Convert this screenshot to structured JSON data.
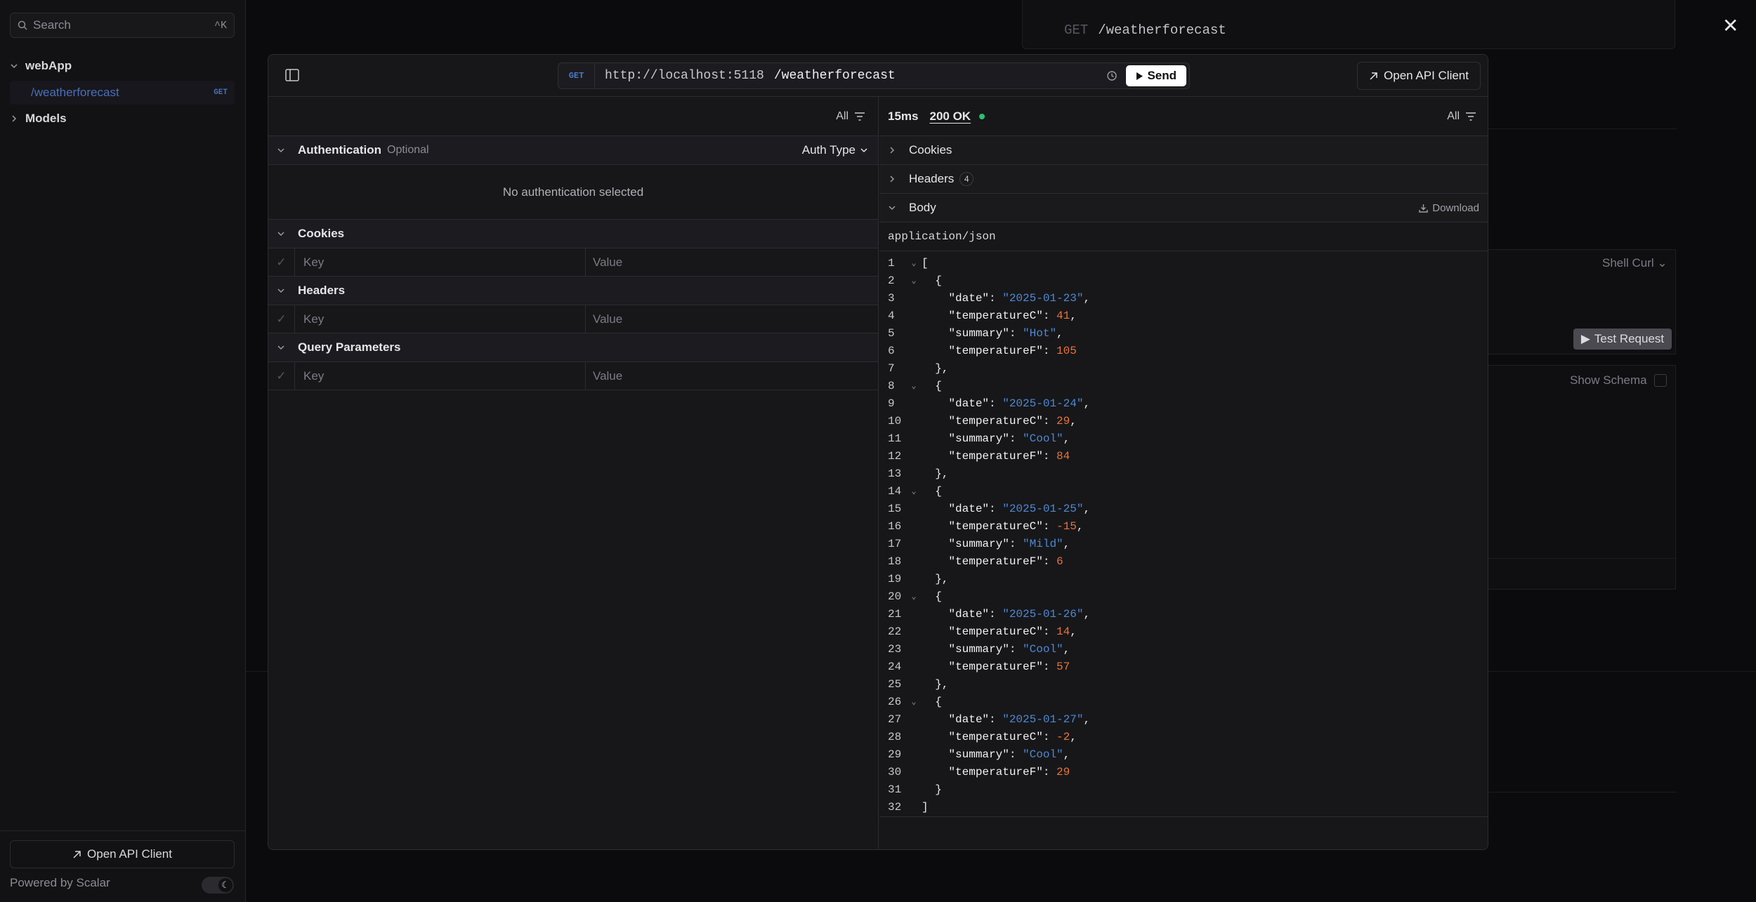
{
  "sidebar": {
    "search_placeholder": "Search",
    "search_shortcut": "^K",
    "group_webapp": "webApp",
    "item_weather": "/weatherforecast",
    "item_weather_method": "GET",
    "group_models": "Models",
    "open_api_client": "Open API Client",
    "powered_by": "Powered by Scalar"
  },
  "background": {
    "method": "GET",
    "path": "/weatherforecast",
    "shell": "Shell Curl",
    "test_request": "Test Request",
    "show_schema": "Show Schema"
  },
  "topbar": {
    "method": "GET",
    "host": "http://localhost:5118",
    "path": "/weatherforecast",
    "send": "Send",
    "open_api_client": "Open API Client"
  },
  "request": {
    "filter": "All",
    "auth_title": "Authentication",
    "auth_optional": "Optional",
    "auth_type": "Auth Type",
    "no_auth": "No authentication selected",
    "cookies": "Cookies",
    "headers": "Headers",
    "query": "Query Parameters",
    "key_placeholder": "Key",
    "value_placeholder": "Value"
  },
  "response": {
    "timing": "15ms",
    "status": "200 OK",
    "filter": "All",
    "cookies": "Cookies",
    "headers": "Headers",
    "headers_count": "4",
    "body": "Body",
    "download": "Download",
    "content_type": "application/json",
    "records": [
      {
        "date": "2025-01-23",
        "temperatureC": 41,
        "summary": "Hot",
        "temperatureF": 105
      },
      {
        "date": "2025-01-24",
        "temperatureC": 29,
        "summary": "Cool",
        "temperatureF": 84
      },
      {
        "date": "2025-01-25",
        "temperatureC": -15,
        "summary": "Mild",
        "temperatureF": 6
      },
      {
        "date": "2025-01-26",
        "temperatureC": 14,
        "summary": "Cool",
        "temperatureF": 57
      },
      {
        "date": "2025-01-27",
        "temperatureC": -2,
        "summary": "Cool",
        "temperatureF": 29
      }
    ]
  },
  "colors": {
    "accent_blue": "#4f88d0",
    "number_orange": "#e6743a",
    "status_green": "#27c26b"
  }
}
